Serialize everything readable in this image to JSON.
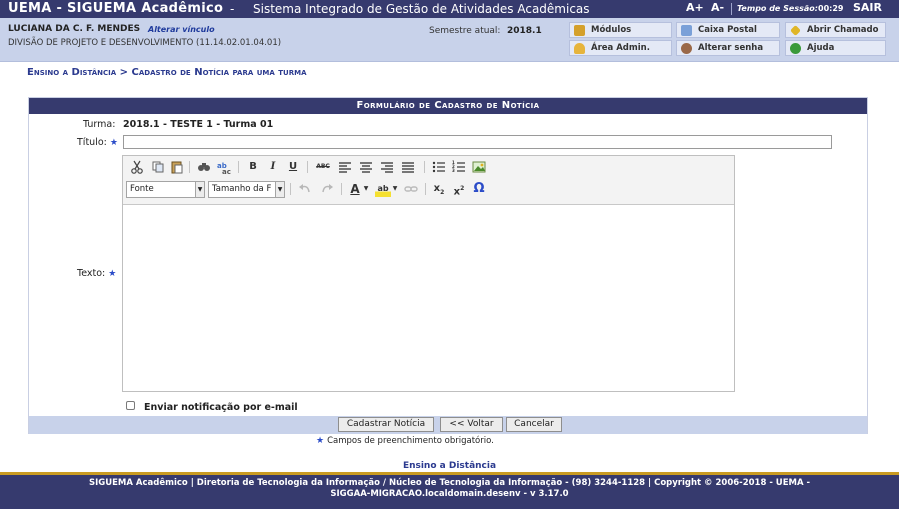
{
  "header": {
    "brand": "UEMA - SIGUEMA Acadêmico",
    "brand_separator": " - ",
    "system_name": "Sistema Integrado de Gestão de Atividades Acadêmicas",
    "font_increase": "A+",
    "font_decrease": "A-",
    "session_label": "Tempo de Sessão:",
    "session_time": "00:29",
    "logout": "SAIR"
  },
  "user": {
    "name": "LUCIANA DA C. F. MENDES",
    "change_link": "Alterar vínculo",
    "department": "DIVISÃO DE PROJETO E DESENVOLVIMENTO (11.14.02.01.04.01)",
    "semester_label": "Semestre atual:",
    "semester_value": "2018.1"
  },
  "quick_links": {
    "modules": "Módulos",
    "mailbox": "Caixa Postal",
    "open_ticket": "Abrir Chamado",
    "admin_area": "Área Admin.",
    "change_password": "Alterar senha",
    "help": "Ajuda"
  },
  "breadcrumb": {
    "parent": "Ensino a Distância",
    "separator": ">",
    "current": "Cadastro de Notícia para uma turma"
  },
  "form": {
    "title": "Formulário de Cadastro de Notícia",
    "turma_label": "Turma:",
    "turma_value": "2018.1 - TESTE 1 - Turma 01",
    "title_label": "Título:",
    "title_value": "",
    "text_label": "Texto:",
    "required_star": "★",
    "notify_label": "Enviar notificação por e-mail",
    "notify_checked": false,
    "buttons": {
      "submit": "Cadastrar Notícia",
      "back": "<< Voltar",
      "cancel": "Cancelar"
    },
    "required_note": "Campos de preenchimento obrigatório."
  },
  "editor": {
    "font_select": "Fonte",
    "size_select": "Tamanho da F",
    "text_content": "",
    "toolbar_icons": [
      "cut-icon",
      "copy-icon",
      "paste-icon",
      "find-icon",
      "replace-icon",
      "bold-icon",
      "italic-icon",
      "underline-icon",
      "strikethrough-icon",
      "align-left-icon",
      "align-center-icon",
      "align-right-icon",
      "align-justify-icon",
      "bullet-list-icon",
      "numbered-list-icon",
      "image-icon",
      "undo-icon",
      "redo-icon",
      "text-color-icon",
      "highlight-icon",
      "link-icon",
      "subscript-icon",
      "superscript-icon",
      "special-char-icon"
    ],
    "glyphs": {
      "bold": "B",
      "italic": "I",
      "underline": "U",
      "strike": "ABC",
      "text_color": "A",
      "highlight": "ab",
      "subscript": "x",
      "superscript": "x",
      "omega": "Ω"
    }
  },
  "footer": {
    "link": "Ensino a Distância",
    "text": "SIGUEMA Acadêmico | Diretoria de Tecnologia da Informação / Núcleo de Tecnologia da Informação - (98) 3244-1128 | Copyright © 2006-2018 - UEMA - SIGGAA-MIGRACAO.localdomain.desenv - v 3.17.0"
  },
  "colors": {
    "header_bg": "#363a6e",
    "userbar_bg": "#c8d2ea",
    "link_blue": "#2b3a8f",
    "footer_border": "#c99b22",
    "required_star": "#2b4cc8"
  }
}
